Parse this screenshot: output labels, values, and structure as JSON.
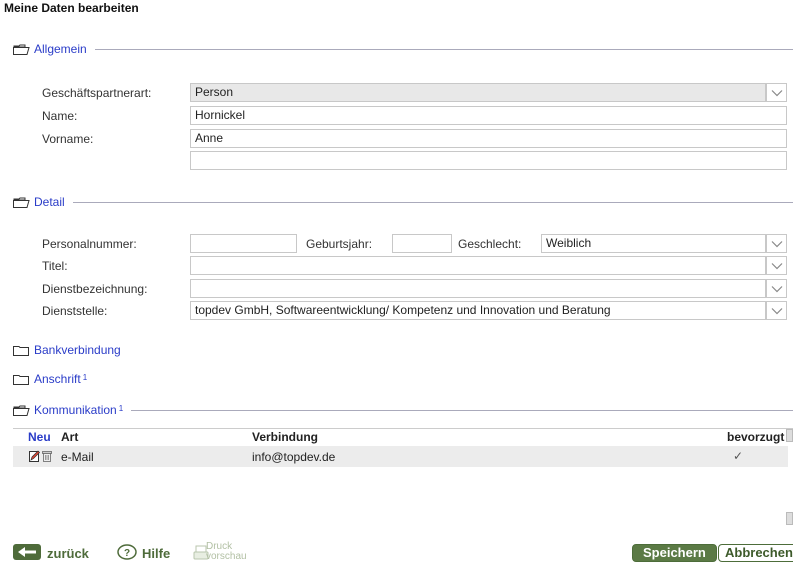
{
  "page": {
    "title": "Meine Daten bearbeiten"
  },
  "sections": {
    "allgemein": "Allgemein",
    "detail": "Detail",
    "bank": "Bankverbindung",
    "anschrift": "Anschrift",
    "anschrift_sup": "1",
    "kommunikation": "Kommunikation",
    "kommunikation_sup": "1"
  },
  "allgemein": {
    "partnerart_label": "Geschäftspartnerart:",
    "partnerart_value": "Person",
    "name_label": "Name:",
    "name_value": "Hornickel",
    "vorname_label": "Vorname:",
    "vorname_value": "Anne",
    "extra_value": ""
  },
  "detail": {
    "personalnummer_label": "Personalnummer:",
    "personalnummer_value": "",
    "geburtsjahr_label": "Geburtsjahr:",
    "geburtsjahr_value": "",
    "geschlecht_label": "Geschlecht:",
    "geschlecht_value": "Weiblich",
    "titel_label": "Titel:",
    "titel_value": "",
    "dienstbezeichnung_label": "Dienstbezeichnung:",
    "dienstbezeichnung_value": "",
    "dienststelle_label": "Dienststelle:",
    "dienststelle_value": "topdev GmbH, Softwareentwicklung/ Kompetenz und Innovation und Beratung"
  },
  "kommunikation": {
    "columns": {
      "neu": "Neu",
      "art": "Art",
      "verbindung": "Verbindung",
      "bevorzugt": "bevorzugt"
    },
    "rows": [
      {
        "art": "e-Mail",
        "verbindung": "info@topdev.de",
        "bevorzugt": "✓"
      }
    ]
  },
  "footer": {
    "zurueck": "zurück",
    "hilfe": "Hilfe",
    "druck": "Druck",
    "vorschau": "vorschau",
    "speichern": "Speichern",
    "abbrechen": "Abbrechen"
  },
  "colors": {
    "section_link": "#2a3cc8",
    "button_green": "#5b7a45",
    "row_bg": "#ececec"
  }
}
